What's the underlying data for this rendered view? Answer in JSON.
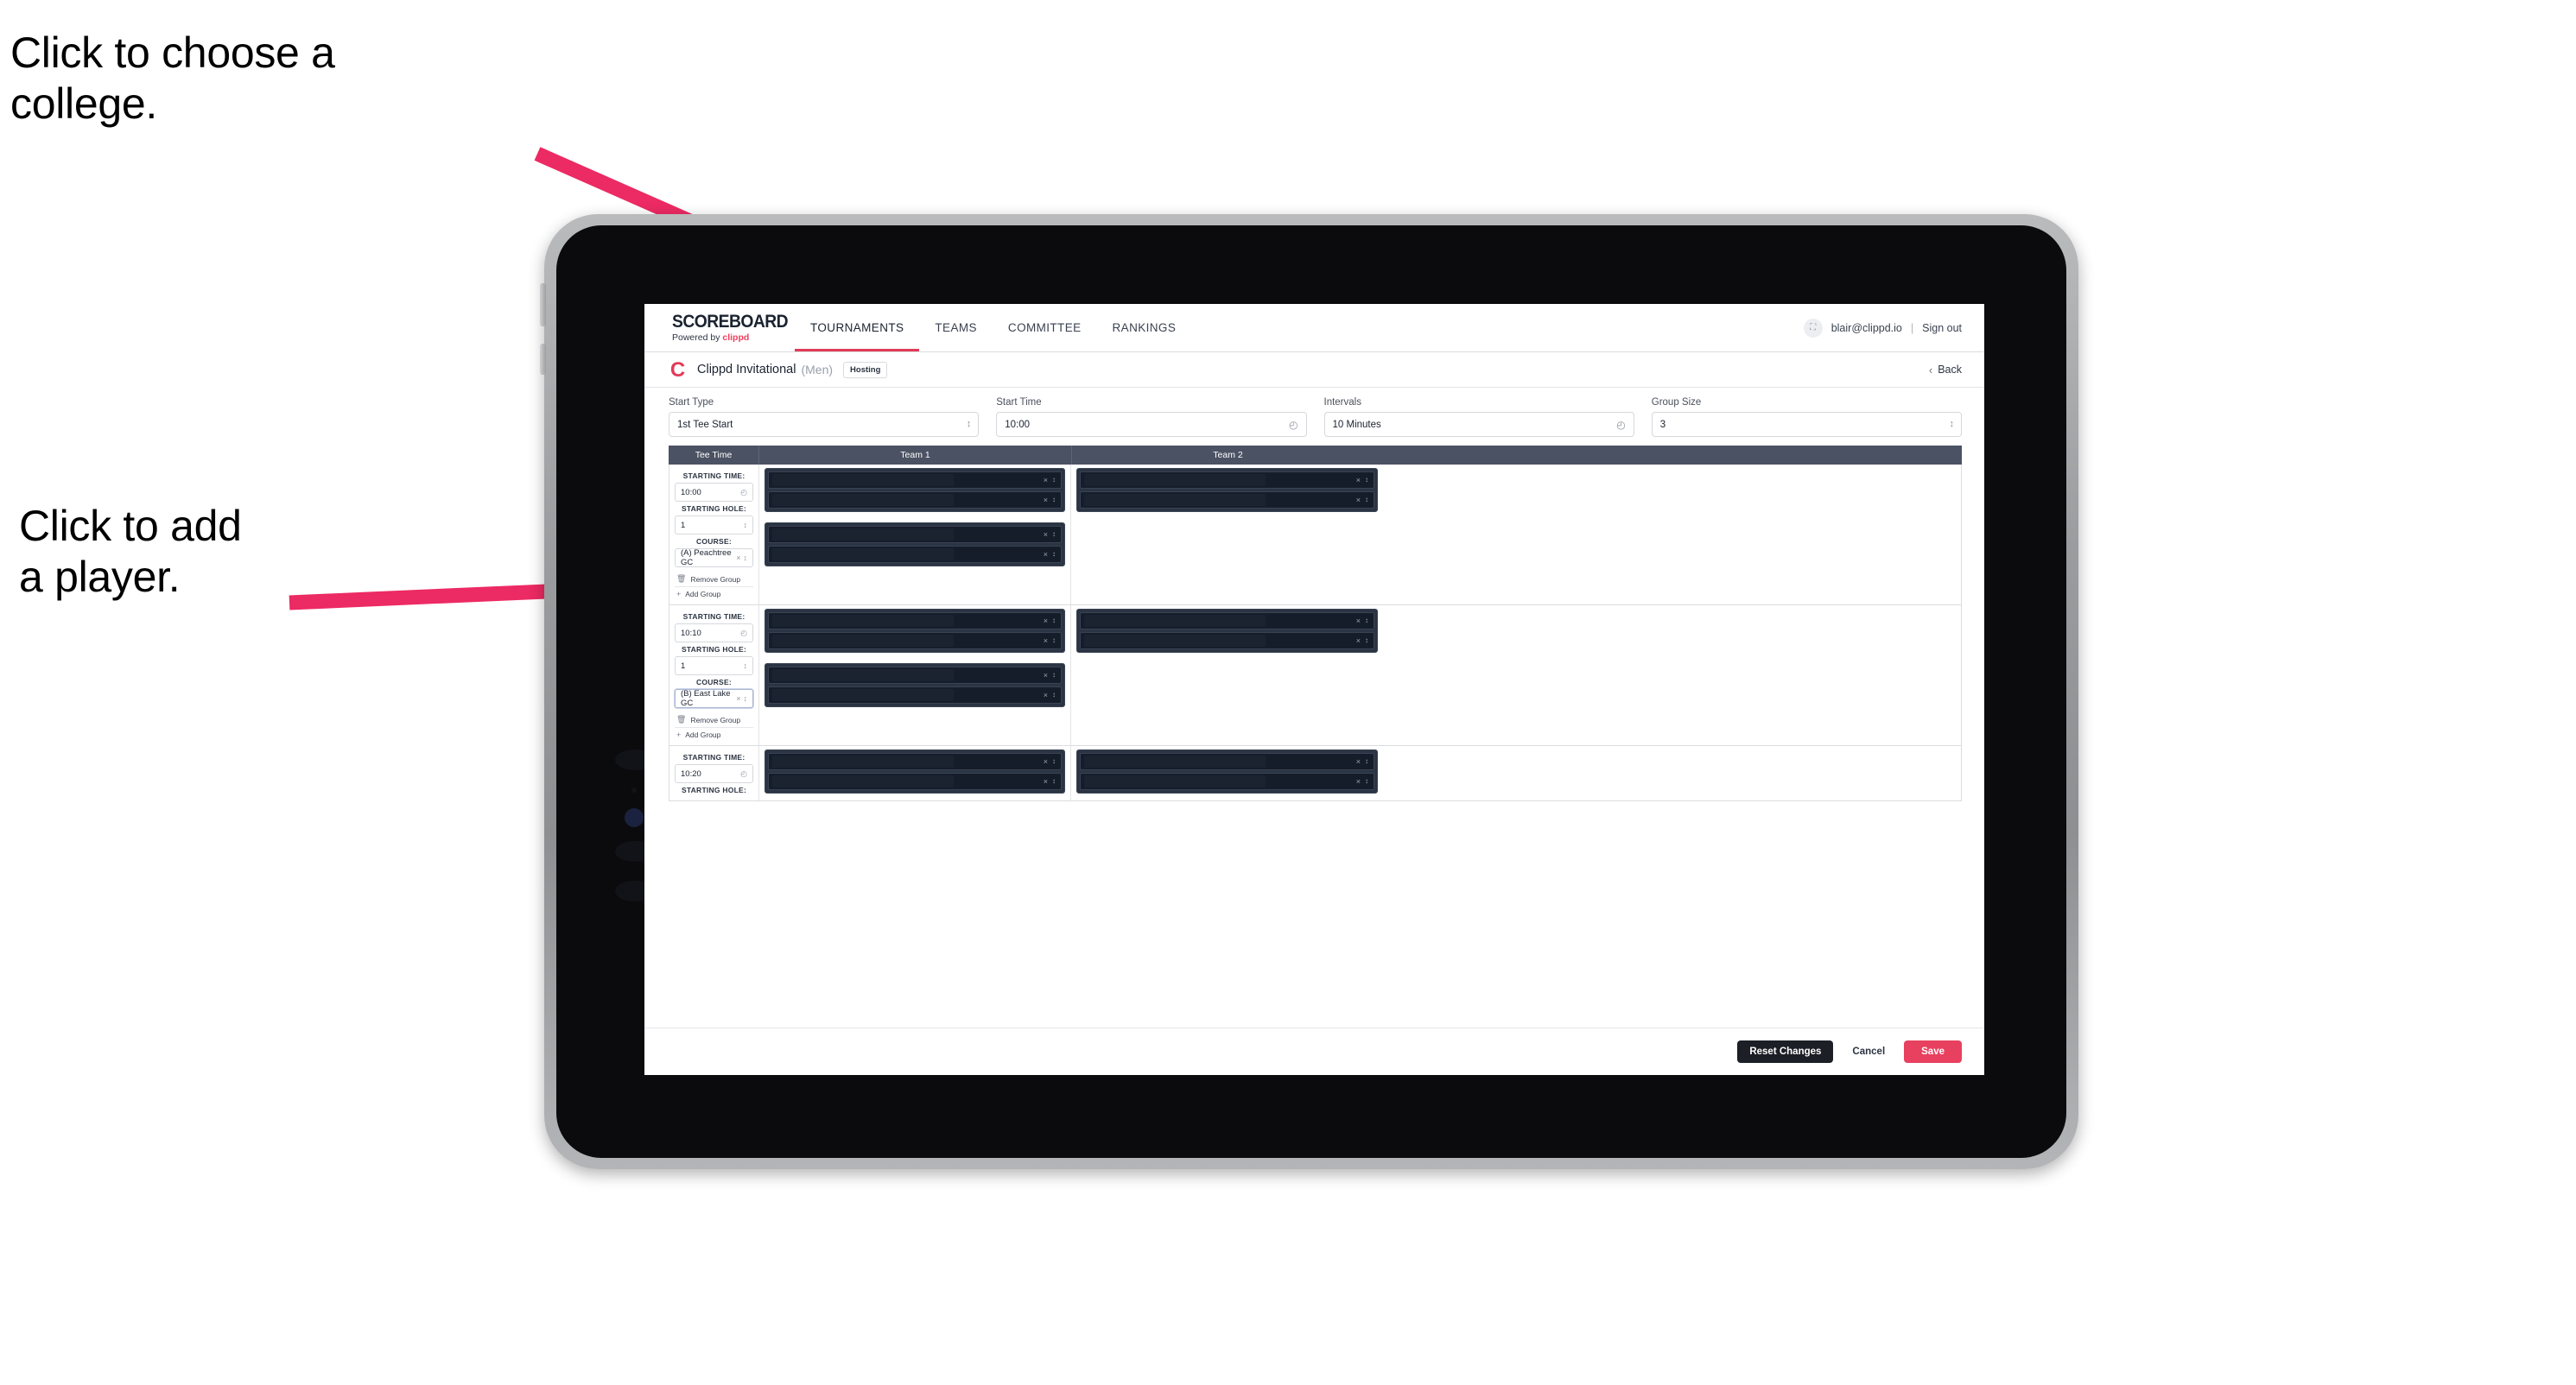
{
  "annotations": {
    "college": "Click to choose a\ncollege.",
    "player": "Click to add\na player."
  },
  "colors": {
    "accent_pink": "#e8405f",
    "arrow_pink": "#ec2a63",
    "table_header": "#4b5263",
    "player_row_dark": "#161d2a"
  },
  "topnav": {
    "brand_name": "SCOREBOARD",
    "brand_sub_prefix": "Powered by ",
    "brand_sub_accent": "clippd",
    "tabs": [
      {
        "label": "TOURNAMENTS",
        "active": true
      },
      {
        "label": "TEAMS",
        "active": false
      },
      {
        "label": "COMMITTEE",
        "active": false
      },
      {
        "label": "RANKINGS",
        "active": false
      }
    ],
    "avatar_glyph": "⛶",
    "email": "blair@clippd.io",
    "separator": "|",
    "sign_out": "Sign out"
  },
  "tournament": {
    "logo_letter": "C",
    "title": "Clippd Invitational",
    "gender": "(Men)",
    "badge": "Hosting",
    "back_label": "Back",
    "back_chevron": "‹"
  },
  "controls": [
    {
      "label": "Start Type",
      "value": "1st Tee Start",
      "icon": "stepper-icon"
    },
    {
      "label": "Start Time",
      "value": "10:00",
      "icon": "clock-icon"
    },
    {
      "label": "Intervals",
      "value": "10 Minutes",
      "icon": "clock-icon"
    },
    {
      "label": "Group Size",
      "value": "3",
      "icon": "stepper-icon"
    }
  ],
  "table": {
    "headers": [
      "Tee Time",
      "Team 1",
      "Team 2"
    ],
    "sublabels": {
      "time": "STARTING TIME:",
      "hole": "STARTING HOLE:",
      "course": "COURSE:"
    },
    "group_actions": {
      "remove": "Remove Group",
      "remove_icon": "trash-icon",
      "add": "Add Group",
      "add_icon": "plus-icon"
    },
    "row_icons": {
      "clear": "×",
      "stepper": "↕"
    },
    "rows": [
      {
        "time": "10:00",
        "hole": "1",
        "course": "(A) Peachtree GC",
        "course_focused": false,
        "team1_groups": [
          2,
          2
        ],
        "team2_groups": [
          2
        ]
      },
      {
        "time": "10:10",
        "hole": "1",
        "course": "(B) East Lake GC",
        "course_focused": true,
        "team1_groups": [
          2,
          2
        ],
        "team2_groups": [
          2
        ]
      },
      {
        "time": "10:20",
        "hole": "",
        "course": "",
        "course_focused": false,
        "team1_groups": [
          2
        ],
        "team2_groups": [
          2
        ]
      }
    ]
  },
  "footer": {
    "reset": "Reset Changes",
    "cancel": "Cancel",
    "save": "Save"
  }
}
